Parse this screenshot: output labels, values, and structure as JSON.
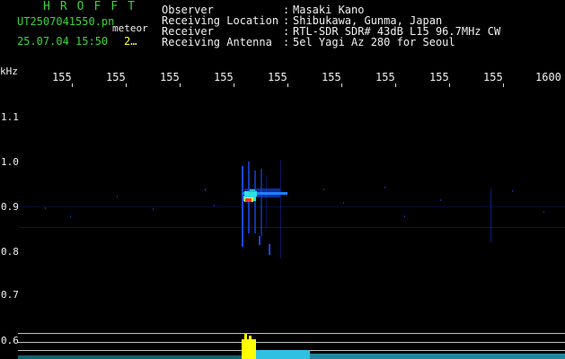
{
  "header": {
    "brand": "HROFFT",
    "filename": "UT2507041550.pn",
    "detection": "meteor",
    "timestamp": "25.07.04 15:50",
    "count": "2…"
  },
  "info": [
    {
      "label": "Observer",
      "value": "Masaki Kano"
    },
    {
      "label": "Receiving Location",
      "value": "Shibukawa, Gunma, Japan"
    },
    {
      "label": "Receiver",
      "value": "RTL-SDR SDR# 43dB L15 96.7MHz CW"
    },
    {
      "label": "Receiving Antenna",
      "value": "5el Yagi Az 280 for Seoul"
    }
  ],
  "separator": ":",
  "axis": {
    "y_unit": "kHz",
    "x_ticks": [
      "155",
      "155",
      "155",
      "155",
      "155",
      "155",
      "155",
      "155",
      "155",
      "1600"
    ],
    "y_ticks": [
      "1.1",
      "1.0",
      "0.9",
      "0.8",
      "0.7",
      "0.6"
    ]
  },
  "colors": {
    "background": "#000000",
    "text_green": "#3cd23c",
    "text_yellow": "#ffff3c",
    "waterfall_dim": "#1030c0",
    "waterfall_hot": "#ff3030",
    "profile_peak": "#ffff00",
    "profile_base": "#30c0e0"
  }
}
